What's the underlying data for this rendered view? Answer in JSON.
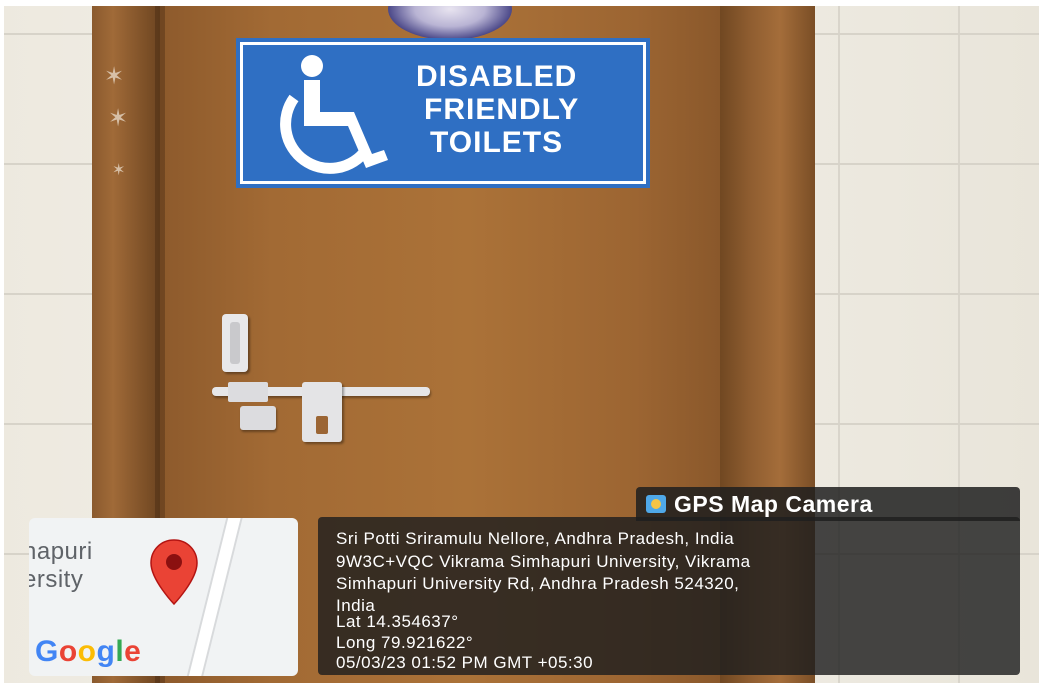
{
  "sign": {
    "line1": "DISABLED",
    "line2": "FRIENDLY",
    "line3": "TOILETS"
  },
  "map": {
    "label_line1": "hapuri",
    "label_line2": "ersity",
    "logo": "Google",
    "logo_colors": [
      "#4285F4",
      "#EA4335",
      "#FBBC05",
      "#4285F4",
      "#34A853",
      "#EA4335"
    ],
    "pin_color": "#EA4335"
  },
  "overlay": {
    "app_title": "GPS Map Camera",
    "lines": [
      "Sri Potti Sriramulu Nellore, Andhra Pradesh, India",
      "9W3C+VQC Vikrama Simhapuri University, Vikrama",
      "Simhapuri University Rd, Andhra Pradesh 524320,",
      "India",
      "Lat 14.354637°",
      "Long 79.921622°",
      "05/03/23 01:52 PM GMT +05:30"
    ]
  },
  "colors": {
    "sign_blue": "#2F6FC3",
    "door_brown": "#A66E36"
  }
}
